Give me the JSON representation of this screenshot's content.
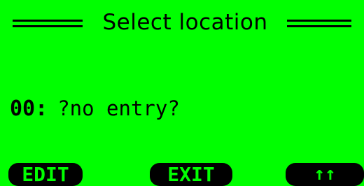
{
  "header": {
    "title": "Select location"
  },
  "entry": {
    "index": "00:",
    "value": "?no entry?"
  },
  "softkeys": {
    "edit": "EDIT",
    "exit": "EXIT",
    "up": "↑↑"
  },
  "colors": {
    "background": "#00ff00",
    "foreground": "#000000"
  }
}
